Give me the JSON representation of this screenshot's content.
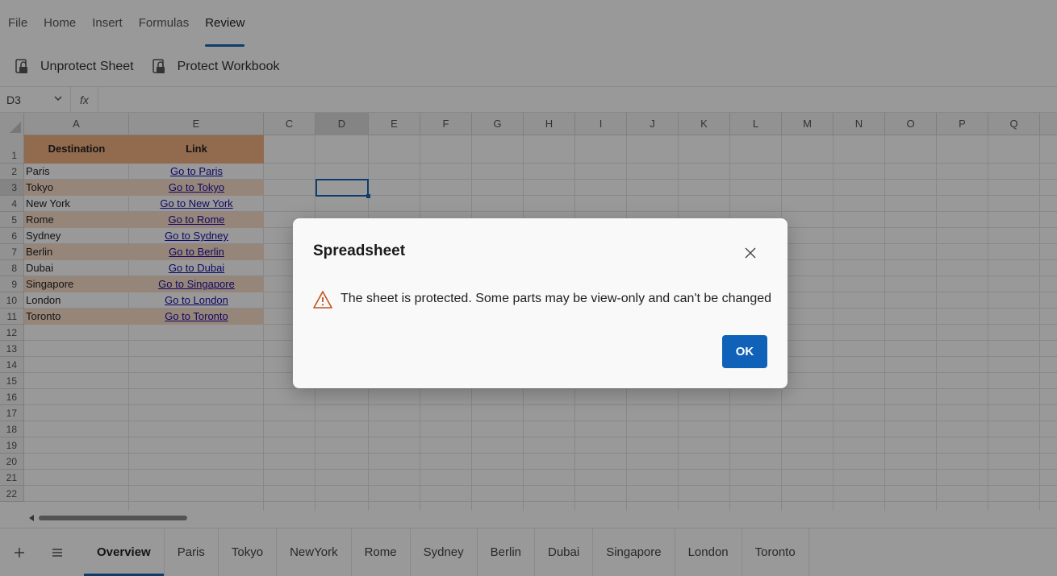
{
  "ribbon": {
    "tabs": [
      {
        "label": "File"
      },
      {
        "label": "Home"
      },
      {
        "label": "Insert"
      },
      {
        "label": "Formulas"
      },
      {
        "label": "Review",
        "active": true
      }
    ]
  },
  "toolbar": {
    "unprotect_sheet": "Unprotect Sheet",
    "protect_workbook": "Protect Workbook"
  },
  "formula_bar": {
    "cell_ref": "D3",
    "fx_label": "fx",
    "value": ""
  },
  "grid": {
    "columns": [
      "A",
      "E",
      "C",
      "D",
      "E",
      "F",
      "G",
      "H",
      "I",
      "J",
      "K",
      "L",
      "M",
      "N",
      "O",
      "P",
      "Q"
    ],
    "selected_column": "D",
    "rows": [
      "1",
      "2",
      "3",
      "4",
      "5",
      "6",
      "7",
      "8",
      "9",
      "10",
      "11",
      "12",
      "13",
      "14",
      "15",
      "16",
      "17",
      "18",
      "19",
      "20",
      "21",
      "22"
    ],
    "selected_row": "3",
    "header": {
      "destination": "Destination",
      "link": "Link"
    },
    "data_rows": [
      {
        "destination": "Paris",
        "link": "Go to Paris"
      },
      {
        "destination": "Tokyo",
        "link": "Go to Tokyo"
      },
      {
        "destination": "New York",
        "link": "Go to New York"
      },
      {
        "destination": "Rome",
        "link": "Go to Rome"
      },
      {
        "destination": "Sydney",
        "link": "Go to Sydney"
      },
      {
        "destination": "Berlin",
        "link": "Go to Berlin"
      },
      {
        "destination": "Dubai",
        "link": "Go to Dubai"
      },
      {
        "destination": "Singapore",
        "link": "Go to Singapore"
      },
      {
        "destination": "London",
        "link": "Go to London"
      },
      {
        "destination": "Toronto",
        "link": "Go to Toronto"
      }
    ]
  },
  "sheet_tabs": {
    "add_icon": "plus-icon",
    "menu_icon": "hamburger-icon",
    "tabs": [
      {
        "label": "Overview",
        "active": true
      },
      {
        "label": "Paris"
      },
      {
        "label": "Tokyo"
      },
      {
        "label": "NewYork"
      },
      {
        "label": "Rome"
      },
      {
        "label": "Sydney"
      },
      {
        "label": "Berlin"
      },
      {
        "label": "Dubai"
      },
      {
        "label": "Singapore"
      },
      {
        "label": "London"
      },
      {
        "label": "Toronto"
      }
    ]
  },
  "dialog": {
    "title": "Spreadsheet",
    "message": "The sheet is protected. Some parts may be view-only and can't be changed",
    "ok_label": "OK",
    "icon": "warning-icon"
  },
  "colors": {
    "accent": "#1a66b3",
    "header_fill": "#f4b183",
    "band_fill": "#fbe0cb",
    "warning": "#c4511d",
    "ok_button": "#0f62b8"
  }
}
